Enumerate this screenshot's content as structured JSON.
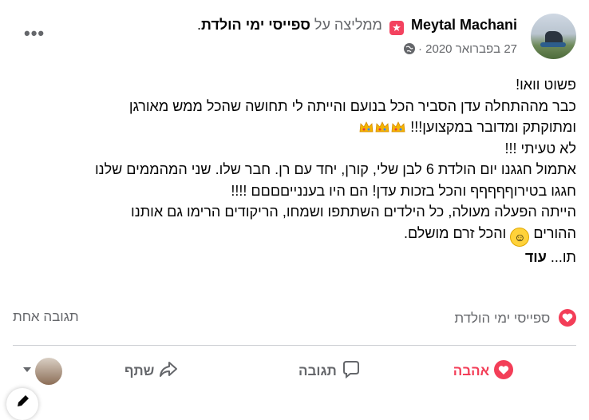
{
  "header": {
    "author": "Meytal Machani",
    "recommends_text": "ממליצה על",
    "page_name": "ספייסי ימי הולדת",
    "period": ".",
    "date": "27 בפברואר 2020",
    "separator": "·",
    "privacy_icon": "globe-icon",
    "more_icon": "more-options-icon"
  },
  "post": {
    "lines": [
      "פשוט וואו!",
      "כבר מההתחלה עדן הסביר הכל בנועם והייתה לי תחושה שהכל ממש מאורגן",
      "ומתוקתק ומדובר במקצוען!!!",
      "לא טעיתי !!!",
      "אתמול חגגנו יום הולדת 6 לבן שלי, קורן, יחד עם רן. חבר שלו. שני המהממים שלנו",
      "חגגו בטירוףףףףף והכל בזכות עדן! הם היו בעננייםםםם !!!!",
      "הייתה הפעלה מעולה,  כל הילדים השתתפו ושמחו, הריקודים הרימו גם אותנו",
      "ההורים",
      "והכל זרם מושלם."
    ],
    "crown_icons": [
      "crown-icon",
      "crown-icon",
      "crown-icon"
    ],
    "smile_icon": "smiling-face-icon",
    "truncation": "תו...",
    "see_more": "עוד"
  },
  "stats": {
    "reaction_icon": "heart-reaction-icon",
    "reaction_label": "ספייסי ימי הולדת",
    "comments_count": "תגובה אחת"
  },
  "actions": {
    "love": "אהבה",
    "comment": "תגובה",
    "share": "שתף"
  },
  "colors": {
    "love_red": "#f33e58",
    "muted_gray": "#65676b",
    "text": "#050505",
    "divider": "#ced0d4"
  }
}
